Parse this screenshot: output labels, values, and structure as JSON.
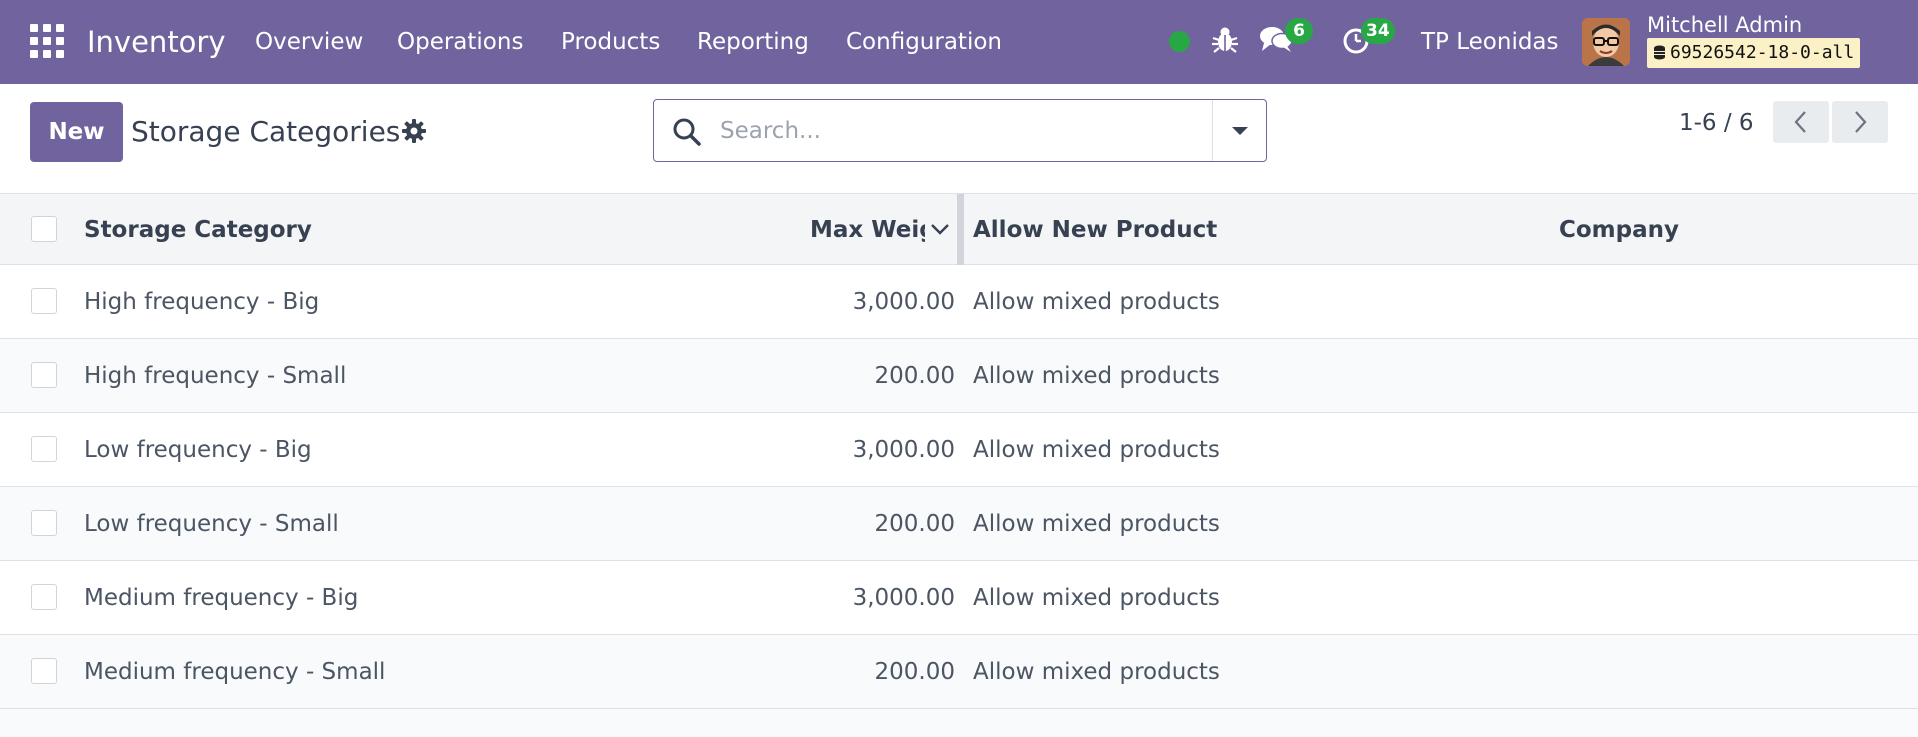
{
  "navbar": {
    "app_name": "Inventory",
    "menu": [
      "Overview",
      "Operations",
      "Products",
      "Reporting",
      "Configuration"
    ],
    "messages_count": "6",
    "activities_count": "34",
    "company": "TP Leonidas",
    "user_name": "Mitchell Admin",
    "database": "69526542-18-0-all",
    "presence_color": "#28a745",
    "brand_color": "#71639e"
  },
  "control_panel": {
    "new_label": "New",
    "title": "Storage Categories",
    "search_placeholder": "Search...",
    "pager": "1-6 / 6"
  },
  "table": {
    "columns": [
      "Storage Category",
      "Max Weig",
      "Allow New Product",
      "Company"
    ],
    "rows": [
      {
        "name": "High frequency - Big",
        "max_weight": "3,000.00",
        "allow_new_product": "Allow mixed products",
        "company": ""
      },
      {
        "name": "High frequency - Small",
        "max_weight": "200.00",
        "allow_new_product": "Allow mixed products",
        "company": ""
      },
      {
        "name": "Low frequency - Big",
        "max_weight": "3,000.00",
        "allow_new_product": "Allow mixed products",
        "company": ""
      },
      {
        "name": "Low frequency - Small",
        "max_weight": "200.00",
        "allow_new_product": "Allow mixed products",
        "company": ""
      },
      {
        "name": "Medium frequency - Big",
        "max_weight": "3,000.00",
        "allow_new_product": "Allow mixed products",
        "company": ""
      },
      {
        "name": "Medium frequency - Small",
        "max_weight": "200.00",
        "allow_new_product": "Allow mixed products",
        "company": ""
      }
    ]
  }
}
